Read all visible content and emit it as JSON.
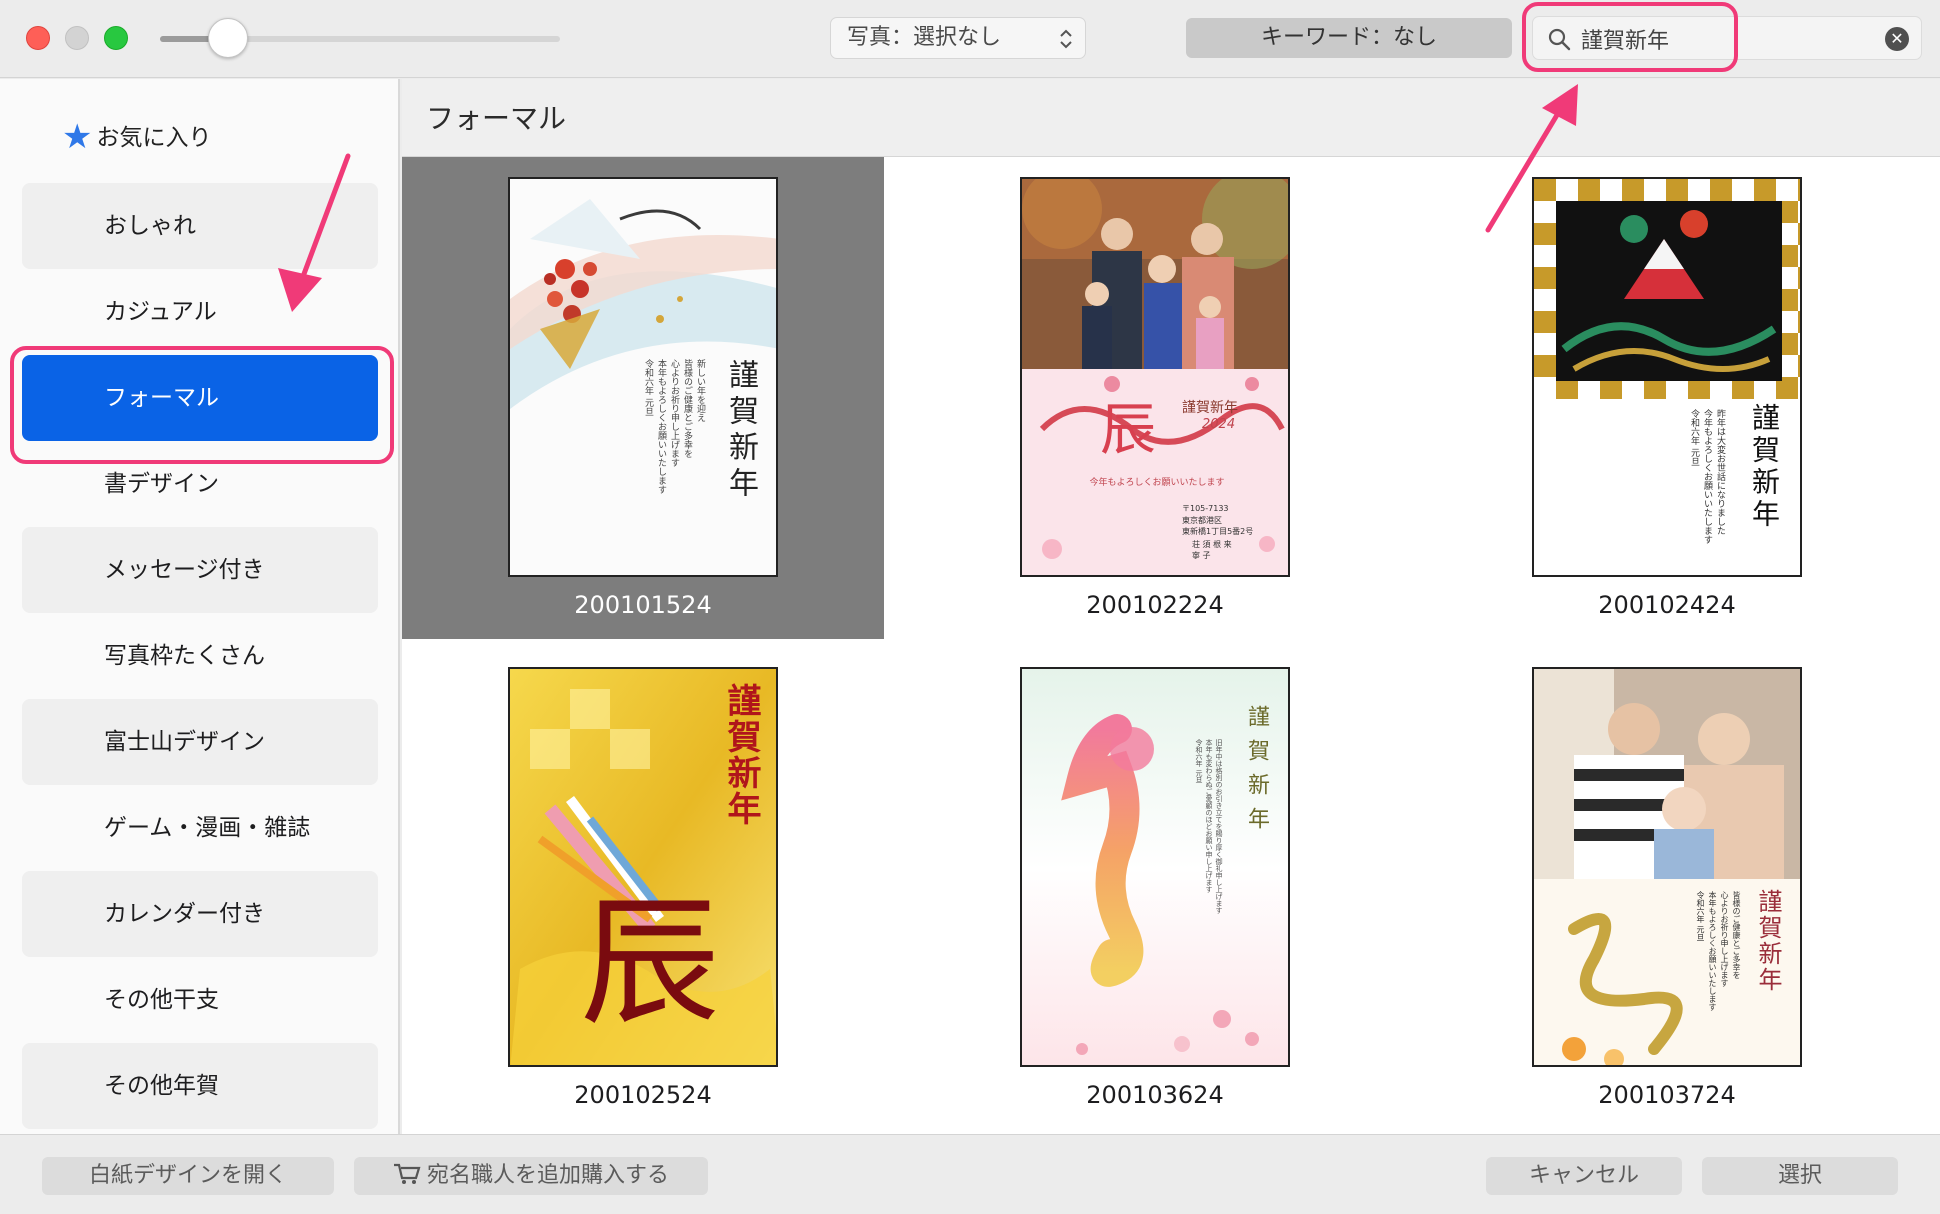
{
  "toolbar": {
    "slider_value": 0.12,
    "photo_filter_label": "写真：選択なし",
    "keyword_label": "キーワード：なし",
    "search_value": "謹賀新年"
  },
  "sidebar": {
    "favorites_label": "お気に入り",
    "items": [
      {
        "label": "おしゃれ"
      },
      {
        "label": "カジュアル"
      },
      {
        "label": "フォーマル"
      },
      {
        "label": "書デザイン"
      },
      {
        "label": "メッセージ付き"
      },
      {
        "label": "写真枠たくさん"
      },
      {
        "label": "富士山デザイン"
      },
      {
        "label": "ゲーム・漫画・雑誌"
      },
      {
        "label": "カレンダー付き"
      },
      {
        "label": "その他干支"
      },
      {
        "label": "その他年賀"
      }
    ],
    "selected_index": 2
  },
  "main": {
    "title": "フォーマル",
    "designs": [
      {
        "id": "200101524"
      },
      {
        "id": "200102224"
      },
      {
        "id": "200102424"
      },
      {
        "id": "200102524"
      },
      {
        "id": "200103624"
      },
      {
        "id": "200103724"
      }
    ],
    "selected_index": 0
  },
  "cards": {
    "greeting": "謹賀新年",
    "greeting_v": "謹賀新年",
    "dragon_kanji": "辰",
    "year_2024": "2024",
    "card2_line": "今年もよろしくお願いいたします",
    "card2_zip": "〒105-7133",
    "card2_address": "東京都港区\n東新橋1丁目5番2号",
    "card2_names": "荘 須 根 来\n寧 子",
    "card1_message": "新しい年を迎え\n皆様のご健康とご多幸を\n心よりお祈り申し上げます\n本年もよろしくお願いいたします\n令和六年 元旦",
    "card3_message": "昨年は大変お世話になりました\n今年もよろしくお願いいたします\n令和六年 元旦",
    "card5_message": "旧年中は格別のお引き立てを賜り厚く御礼申し上げます\n本年も変わらぬご愛顧のほどお願い申し上げます\n令和六年 元旦",
    "card6_message": "皆様のご健康とご多幸を\n心よりお祈り申し上げます\n本年もよろしくお願いいたします\n令和六年 元旦"
  },
  "bottom": {
    "open_blank_label": "白紙デザインを開く",
    "buy_label": "宛名職人を追加購入する",
    "cancel_label": "キャンセル",
    "select_label": "選択"
  },
  "colors": {
    "selected_blue": "#0a63e6",
    "highlight_pink": "#f03a78"
  }
}
